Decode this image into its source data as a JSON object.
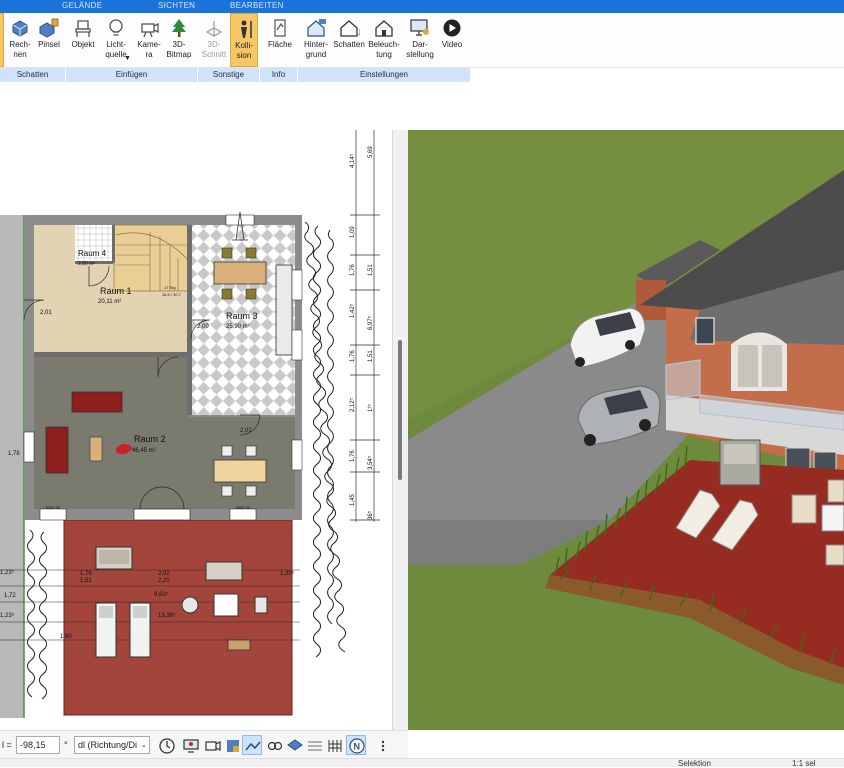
{
  "ribbon": {
    "tabs": [
      "GELÄNDE",
      "SICHTEN",
      "BEARBEITEN"
    ],
    "buttons": {
      "rechnen": "Rech-\nnen",
      "pinsel": "Pinsel",
      "objekt": "Objekt",
      "lichtquelle": "Licht-\nquelle",
      "kamera": "Kame-\nra",
      "bitmap3d": "3D-\nBitmap",
      "schnitt3d": "3D-\nSchnitt",
      "kollision": "Kolli-\nsion",
      "flaeche": "Fläche",
      "hintergrund": "Hinter-\ngrund",
      "schatten": "Schatten",
      "beleuchtung": "Beleuch-\ntung",
      "darstellung": "Dar-\nstellung",
      "video": "Video"
    },
    "groups": [
      "Schatten",
      "Einfügen",
      "Sonstige",
      "Info",
      "Einstellungen"
    ]
  },
  "plan": {
    "rooms": [
      {
        "name": "Raum 4",
        "area": "2,80 m²"
      },
      {
        "name": "Raum 1",
        "area": "20,11 m²"
      },
      {
        "name": "Raum 3",
        "area": "25,90 m²"
      },
      {
        "name": "Raum 2",
        "area": "46,45 m²"
      }
    ],
    "dims_right": [
      "4,14⁵",
      "5,69",
      "1,09",
      "1,76",
      "1,51",
      "1,42⁵",
      "6,97⁵",
      "1,76",
      "1,51",
      "2,12⁵",
      "1¹⁵",
      "1,76",
      "3,54⁵",
      "1,45",
      "36⁵"
    ],
    "dims_terrace": [
      "1,76",
      "1,51",
      "2,02",
      "2,20",
      "1,30⁵",
      "9,63⁵",
      "1,23⁵",
      "1,72",
      "1,23⁵",
      "1,60",
      "13,36⁵"
    ],
    "small_labels": [
      "2,01",
      "2,00",
      "2,01",
      "1,78",
      "BRH 95",
      "BRH 50",
      "17 Stg",
      "16,5 / 30,7"
    ]
  },
  "toolbar": {
    "angle_label": "l =",
    "angle_value": "-98,15",
    "angle_unit": "°",
    "direction_value": "dl (Richtung/Di"
  },
  "status": {
    "mode": "Selektion",
    "scale": "1:1 sel"
  },
  "colors": {
    "ribbon_blue": "#1a73d9",
    "group_bar": "#cfe3fb",
    "active_button": "#f7c766",
    "lawn": "#6e8a3c",
    "terrace": "#8e2b24",
    "driveway": "#8a8a8a"
  }
}
